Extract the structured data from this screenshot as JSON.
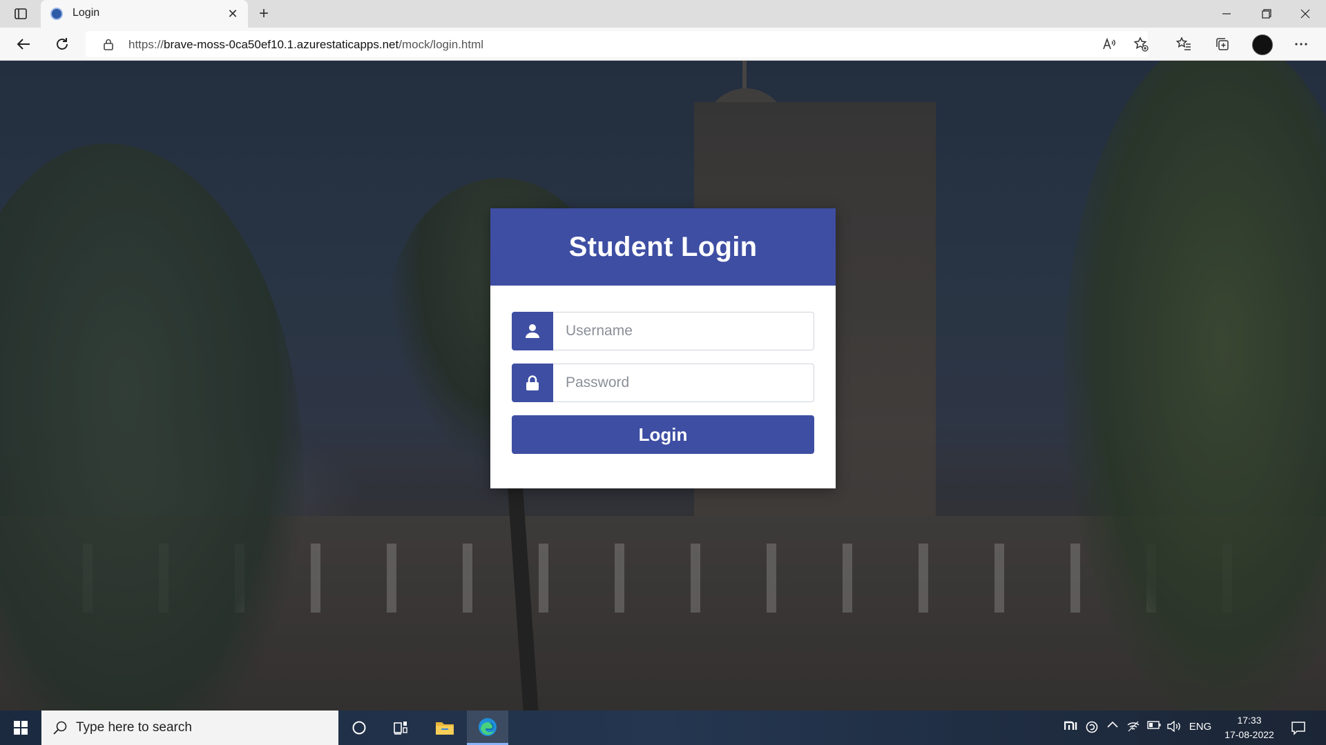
{
  "browser": {
    "tab_title": "Login",
    "tab_close": "✕",
    "new_tab": "+",
    "url_scheme": "https://",
    "url_host": "brave-moss-0ca50ef10.1.azurestaticapps.net",
    "url_path": "/mock/login.html"
  },
  "login": {
    "title": "Student Login",
    "username_placeholder": "Username",
    "password_placeholder": "Password",
    "button_label": "Login",
    "accent_color": "#3e4ea3"
  },
  "taskbar": {
    "search_placeholder": "Type here to search",
    "tray_language": "ENG",
    "time": "17:33",
    "date": "17-08-2022"
  }
}
